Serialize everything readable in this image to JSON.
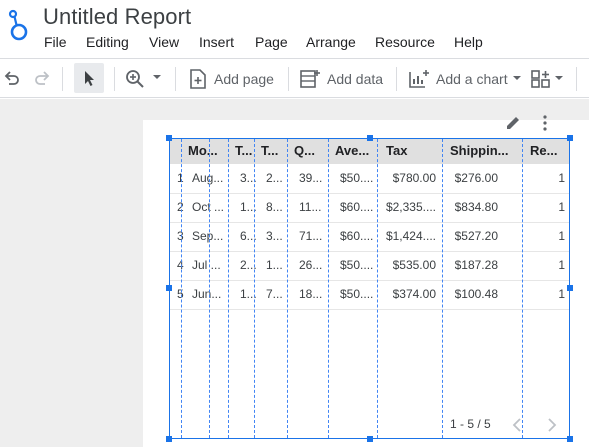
{
  "app": {
    "title": "Untitled Report"
  },
  "menu": [
    "File",
    "Editing",
    "View",
    "Insert",
    "Page",
    "Arrange",
    "Resource",
    "Help"
  ],
  "toolbar": {
    "add_page": "Add page",
    "add_data": "Add data",
    "add_chart": "Add a chart"
  },
  "table": {
    "columns": [
      "Mo...",
      "T...",
      "T...",
      "Q...",
      "Ave...",
      "Tax",
      "Shippin...",
      "Re..."
    ],
    "rows": [
      {
        "num": "1",
        "c0": "Aug...",
        "c1": "3...",
        "c2": "2...",
        "c3": "39...",
        "c4": "$50....",
        "c5": "$780.00",
        "c6": "$276.00",
        "c7": "1"
      },
      {
        "num": "2",
        "c0": "Oct ...",
        "c1": "1...",
        "c2": "8...",
        "c3": "11...",
        "c4": "$60....",
        "c5": "$2,335....",
        "c6": "$834.80",
        "c7": "1"
      },
      {
        "num": "3",
        "c0": "Sep...",
        "c1": "6...",
        "c2": "3...",
        "c3": "71...",
        "c4": "$60....",
        "c5": "$1,424....",
        "c6": "$527.20",
        "c7": "1"
      },
      {
        "num": "4",
        "c0": "Jul ...",
        "c1": "2...",
        "c2": "1...",
        "c3": "26...",
        "c4": "$50....",
        "c5": "$535.00",
        "c6": "$187.28",
        "c7": "1"
      },
      {
        "num": "5",
        "c0": "Jun...",
        "c1": "1...",
        "c2": "7...",
        "c3": "18...",
        "c4": "$50....",
        "c5": "$374.00",
        "c6": "$100.48",
        "c7": "1"
      }
    ],
    "pagination": "1 - 5 / 5"
  },
  "icons": {
    "undo": "undo-icon",
    "redo": "redo-icon",
    "select": "cursor-icon",
    "zoom": "zoom-in-icon",
    "edit": "pencil-icon",
    "more": "more-vert-icon",
    "prev": "chevron-left-icon",
    "next": "chevron-right-icon"
  },
  "colors": {
    "accent": "#1a73e8",
    "header_bg": "#e0e0e0",
    "canvas_bg": "#eeeeee"
  }
}
